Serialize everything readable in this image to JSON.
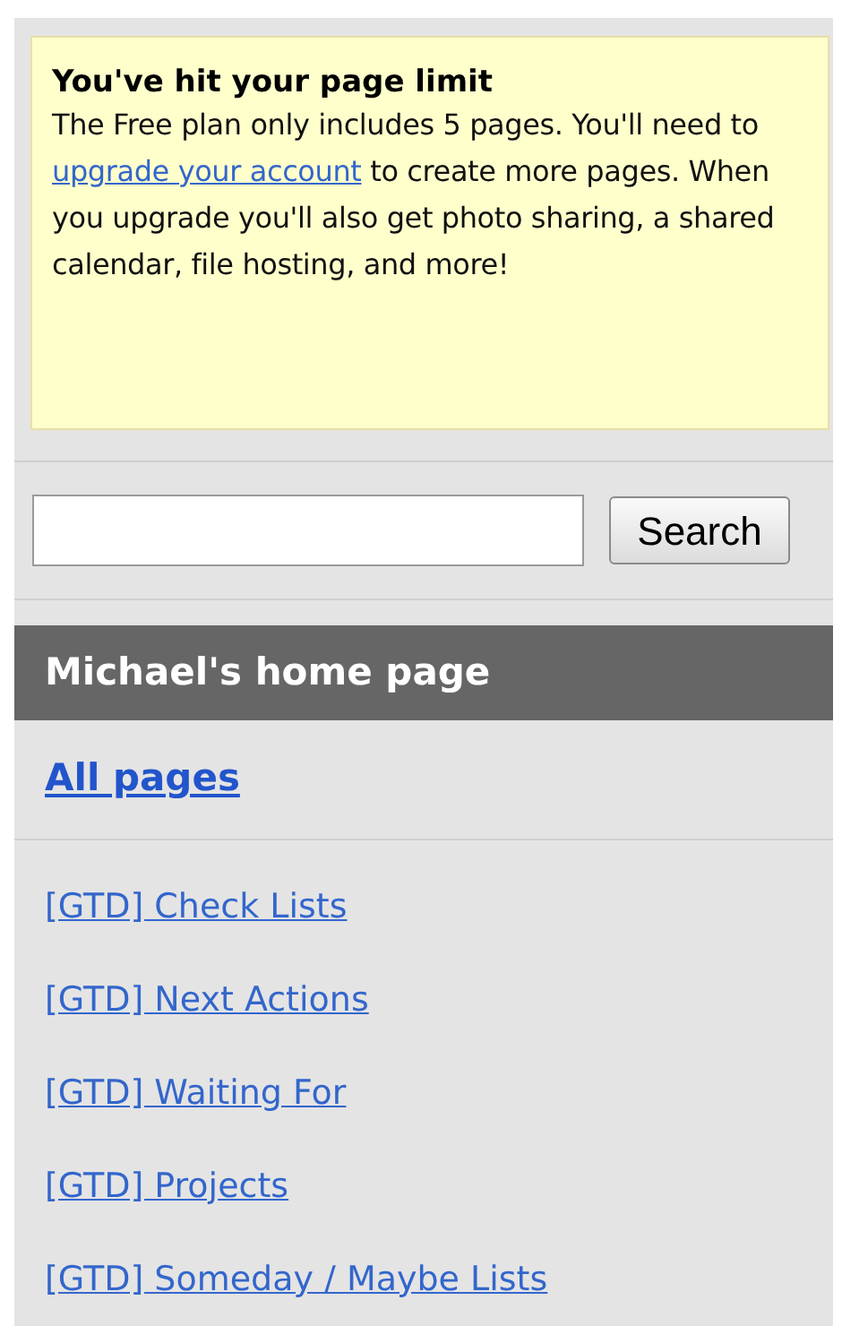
{
  "notice": {
    "title": "You've hit your page limit",
    "text_before": "The Free plan only includes 5 pages. You'll need to",
    "link": "upgrade your account",
    "text_after": "to create more pages. When you upgrade you'll also get photo sharing, a shared calendar, file hosting, and more!"
  },
  "search": {
    "button": "Search"
  },
  "home_header": "Michael's home page",
  "all_pages": "All pages",
  "pages": [
    "[GTD] Check Lists",
    "[GTD] Next Actions",
    "[GTD] Waiting For",
    "[GTD] Projects",
    "[GTD] Someday / Maybe Lists"
  ]
}
